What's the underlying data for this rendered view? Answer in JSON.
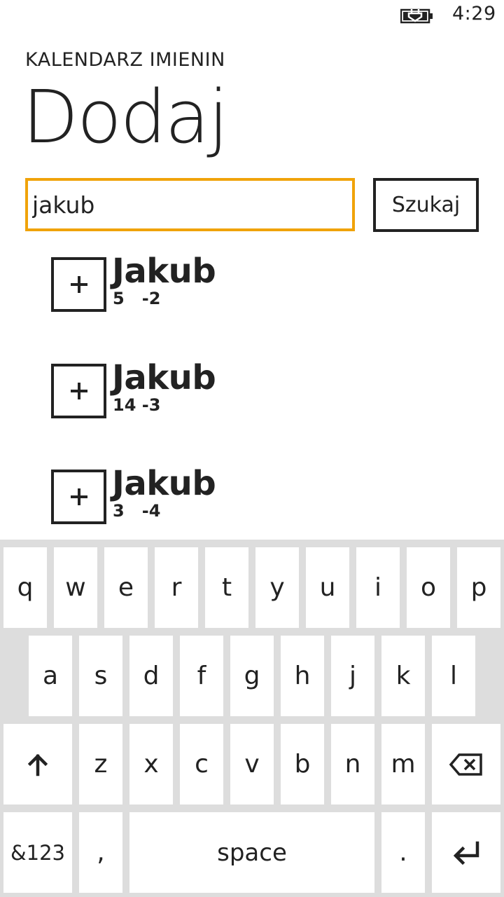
{
  "status_bar": {
    "time": "4:29",
    "battery_icon": "battery-charging-icon"
  },
  "app": {
    "title": "KALENDARZ IMIENIN"
  },
  "page": {
    "title": "Dodaj"
  },
  "search": {
    "value": "jakub",
    "button_label": "Szukaj"
  },
  "results": [
    {
      "name": "Jakub",
      "date": "5   -2",
      "add_icon": "plus-icon"
    },
    {
      "name": "Jakub",
      "date": "14 -3",
      "add_icon": "plus-icon"
    },
    {
      "name": "Jakub",
      "date": "3   -4",
      "add_icon": "plus-icon"
    }
  ],
  "keyboard": {
    "row1": [
      "q",
      "w",
      "e",
      "r",
      "t",
      "y",
      "u",
      "i",
      "o",
      "p"
    ],
    "row2": [
      "a",
      "s",
      "d",
      "f",
      "g",
      "h",
      "j",
      "k",
      "l"
    ],
    "row3": [
      "z",
      "x",
      "c",
      "v",
      "b",
      "n",
      "m"
    ],
    "shift_icon": "shift-arrow-icon",
    "backspace_icon": "backspace-icon",
    "symbols_label": "&123",
    "comma_label": ",",
    "space_label": "space",
    "period_label": ".",
    "enter_icon": "enter-icon"
  },
  "colors": {
    "accent": "#f0a30a",
    "text": "#222222",
    "keyboard_bg": "#dddddd",
    "key_bg": "#ffffff"
  }
}
